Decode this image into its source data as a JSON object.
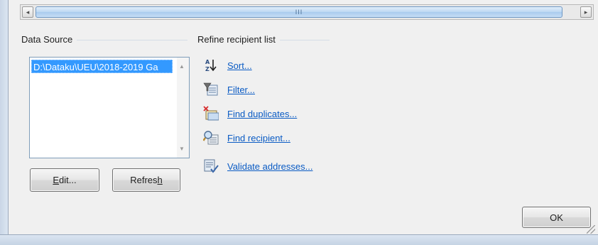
{
  "scrollbar": {
    "left_arrow": "◂",
    "right_arrow": "▸",
    "grip": "III"
  },
  "data_source": {
    "label": "Data Source",
    "selected_item": "D:\\Dataku\\UEU\\2018-2019 Ga",
    "scroll_up": "▲",
    "scroll_down": "▼"
  },
  "buttons": {
    "edit": {
      "key": "E",
      "rest": "dit..."
    },
    "refresh": {
      "prefix": "Refres",
      "key": "h"
    },
    "ok": "OK"
  },
  "refine": {
    "label": "Refine recipient list",
    "items": [
      {
        "label": "Sort...",
        "icon": "sort-az-icon"
      },
      {
        "label": "Filter...",
        "icon": "filter-icon"
      },
      {
        "label": "Find duplicates...",
        "icon": "find-duplicates-icon"
      },
      {
        "label": "Find recipient...",
        "icon": "find-recipient-icon"
      },
      {
        "label": "Validate addresses...",
        "icon": "validate-addresses-icon"
      }
    ]
  },
  "colors": {
    "link": "#0a5bc4",
    "selection": "#3399ff",
    "background": "#f0f0f0"
  }
}
